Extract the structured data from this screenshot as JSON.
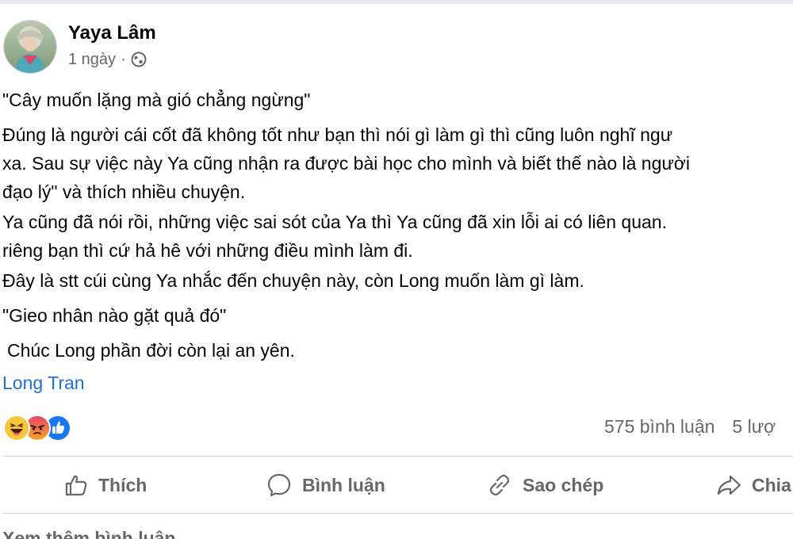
{
  "post": {
    "author": "Yaya Lâm",
    "time": "1 ngày",
    "separator": "·",
    "privacy_icon": "globe-icon",
    "paragraphs": {
      "quote1": "\"Cây muốn lặng mà gió chẳng ngừng\"",
      "main_line1": "Đúng là người cái cốt đã không tốt như bạn thì nói gì làm gì thì cũng luôn nghĩ ngư",
      "main_line2": "xa. Sau sự việc này Ya cũng nhận ra được bài học cho mình và biết thế nào là người",
      "main_line3": "đạo lý\" và thích nhiều chuyện.",
      "ya_line1": "Ya cũng đã nói rồi, những việc sai sót của Ya thì Ya cũng đã xin lỗi ai có liên quan.",
      "ya_line2": "riêng bạn thì cứ hả hê với những điều mình làm đi.",
      "stt": "Đây là stt cúi cùng Ya nhắc đến chuyện này, còn Long muốn làm gì làm.",
      "quote2": "\"Gieo nhân nào gặt quả đó\"",
      "wish": "Chúc Long phần đời còn lại an yên."
    },
    "tag": "Long Tran",
    "reactions": [
      "haha-icon",
      "angry-icon",
      "like-icon"
    ],
    "comments_count": "575 bình luận",
    "shares_count": "5 lượ"
  },
  "actions": {
    "like": "Thích",
    "comment": "Bình luận",
    "copy": "Sao chép",
    "share": "Chia"
  },
  "footer": {
    "see_more": "Xem thêm bình luận"
  },
  "colors": {
    "link": "#216fdb",
    "muted": "#65676b",
    "text": "#050505",
    "divider": "#ced0d4",
    "like_blue": "#1877f2",
    "haha_yellow": "#f7c63a",
    "angry_red": "#e9710f"
  }
}
